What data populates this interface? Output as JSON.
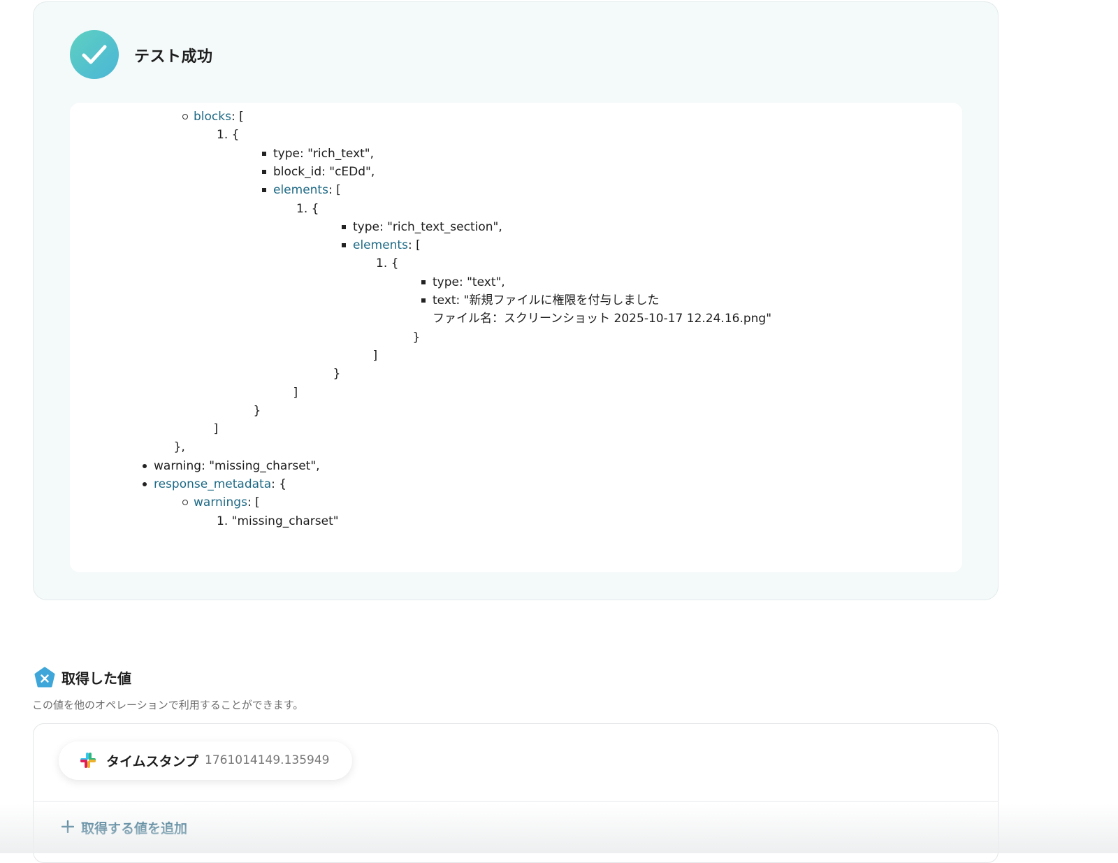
{
  "test_panel": {
    "title": "テスト成功",
    "output_lines": [
      {
        "indent": 2,
        "bullet": "circle",
        "key": "blocks",
        "rest": ": ["
      },
      {
        "indent": 3,
        "bullet": "num",
        "num": "1.",
        "text": "{"
      },
      {
        "indent": 4,
        "bullet": "square",
        "text": "type: \"rich_text\","
      },
      {
        "indent": 4,
        "bullet": "square",
        "text": "block_id: \"cEDd\","
      },
      {
        "indent": 4,
        "bullet": "square",
        "key": "elements",
        "rest": ": ["
      },
      {
        "indent": 5,
        "bullet": "num",
        "num": "1.",
        "text": "{"
      },
      {
        "indent": 6,
        "bullet": "square",
        "text": "type: \"rich_text_section\","
      },
      {
        "indent": 6,
        "bullet": "square",
        "key": "elements",
        "rest": ": ["
      },
      {
        "indent": 7,
        "bullet": "num",
        "num": "1.",
        "text": "{"
      },
      {
        "indent": 8,
        "bullet": "square",
        "text": "type: \"text\","
      },
      {
        "indent": 8,
        "bullet": "square",
        "text": "text: \"新規ファイルに権限を付与しました"
      },
      {
        "indent": 8,
        "bullet": "none",
        "text": "ファイル名：スクリーンショット 2025-10-17 12.24.16.png\""
      },
      {
        "indent": 7.5,
        "bullet": "none",
        "text": "}"
      },
      {
        "indent": 6.5,
        "bullet": "none",
        "text": "]"
      },
      {
        "indent": 5.5,
        "bullet": "none",
        "text": "}"
      },
      {
        "indent": 4.5,
        "bullet": "none",
        "text": "]"
      },
      {
        "indent": 3.5,
        "bullet": "none",
        "text": "}"
      },
      {
        "indent": 2.5,
        "bullet": "none",
        "text": "]"
      },
      {
        "indent": 1.5,
        "bullet": "none",
        "text": "},"
      },
      {
        "indent": 1,
        "bullet": "disc",
        "text": "warning: \"missing_charset\","
      },
      {
        "indent": 1,
        "bullet": "disc",
        "key": "response_metadata",
        "rest": ": {"
      },
      {
        "indent": 2,
        "bullet": "circle",
        "key": "warnings",
        "rest": ": ["
      },
      {
        "indent": 3,
        "bullet": "num",
        "num": "1.",
        "text": "\"missing_charset\""
      }
    ]
  },
  "acquired_values": {
    "icon": "variable-x-icon",
    "title": "取得した値",
    "description": "この値を他のオペレーションで利用することができます。",
    "items": [
      {
        "icon": "slack-icon",
        "label": "タイムスタンプ",
        "value": "1761014149.135949"
      }
    ],
    "add_button_label": "取得する値を追加"
  },
  "colors": {
    "key_text": "#1e6a86",
    "success_gradient_start": "#5fd0c1",
    "success_gradient_end": "#4ab6d6",
    "add_button": "#1f5f7d"
  }
}
